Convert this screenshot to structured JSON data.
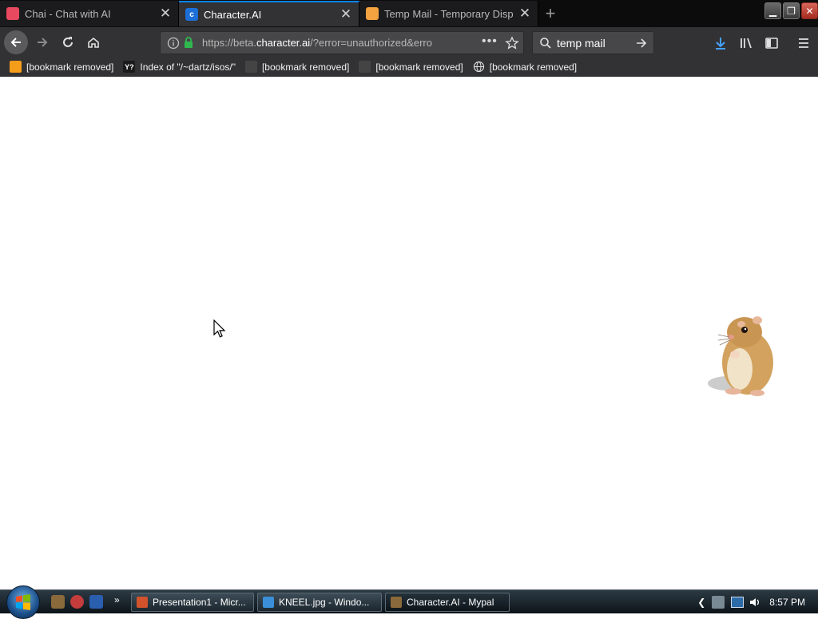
{
  "tabs": [
    {
      "title": "Chai - Chat with AI",
      "active": false,
      "favicon_color": "#e8495e",
      "favicon": "chai-logo-icon"
    },
    {
      "title": "Character.AI",
      "active": true,
      "favicon_color": "#1c6fd6",
      "favicon": "character-ai-logo-icon"
    },
    {
      "title": "Temp Mail - Temporary Dispo",
      "active": false,
      "favicon_color": "#f4a340",
      "favicon": "envelope-icon"
    }
  ],
  "navbar": {
    "url_prefix": "https://beta.",
    "url_domain": "character.ai",
    "url_suffix": "/?error=unauthorized&erro",
    "search_value": "temp mail"
  },
  "bookmarks": [
    {
      "label": "[bookmark removed]",
      "icon": "bookmark-icon",
      "icon_color": "#f59c1a",
      "icon_text": ""
    },
    {
      "label": "Index of \"/~dartz/isos/\"",
      "icon": "yp-icon",
      "icon_color": "#1a1a1a",
      "icon_text": "Y?"
    },
    {
      "label": "[bookmark removed]",
      "icon": "bookmark-icon",
      "icon_color": "#444444",
      "icon_text": ""
    },
    {
      "label": "[bookmark removed]",
      "icon": "bookmark-icon",
      "icon_color": "#444444",
      "icon_text": ""
    },
    {
      "label": "[bookmark removed]",
      "icon": "globe-icon",
      "icon_color": "#444444",
      "icon_text": ""
    }
  ],
  "taskbar": {
    "items": [
      {
        "label": "Presentation1 - Micr...",
        "icon": "powerpoint-icon",
        "icon_color": "#d2532b",
        "active": false
      },
      {
        "label": "KNEEL.jpg - Windo...",
        "icon": "photo-viewer-icon",
        "icon_color": "#3b8fd9",
        "active": false
      },
      {
        "label": "Character.AI - Mypal",
        "icon": "mypal-icon",
        "icon_color": "#8a6a3a",
        "active": true
      }
    ],
    "clock": "8:57 PM"
  },
  "colors": {
    "accent": "#0a84ff",
    "chrome_dark": "#323234",
    "page_background": "#ffffff"
  }
}
